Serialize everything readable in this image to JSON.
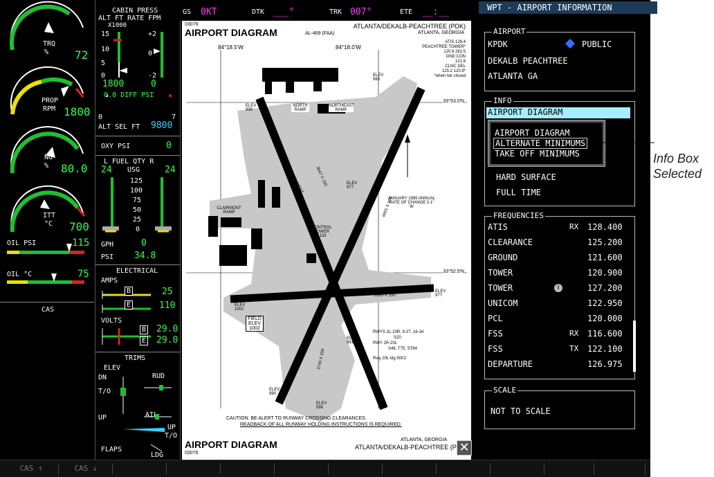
{
  "engine": {
    "trq_label": "TRQ",
    "trq_unit": "%",
    "trq_val": "72",
    "prop_label": "PROP",
    "prop_unit": "RPM",
    "prop_val": "1800",
    "ng_label": "NG",
    "ng_unit": "%",
    "ng_val": "80.0",
    "itt_label": "ITT",
    "itt_unit": "°C",
    "itt_val": "700",
    "oilpsi_label": "OIL PSI",
    "oilpsi_val": "115",
    "oiltemp_label": "OIL °C",
    "oiltemp_val": "75",
    "cas_label": "CAS"
  },
  "cabin": {
    "title": "CABIN PRESS",
    "subtitle": "ALT FT RATE FPM",
    "x1000": "X1000",
    "t15": "15",
    "t10": "10",
    "t5": "5",
    "t0": "0",
    "rp2": "+2",
    "r0": "0",
    "rm2": "-2",
    "alt_val": "1800",
    "rate_val": "0",
    "diff_label": "0.0 DIFF PSI",
    "diff0": "0",
    "diff7": "7",
    "altsel_label": "ALT SEL FT",
    "altsel_val": "9800",
    "oxy_label": "OXY PSI",
    "oxy_val": "0"
  },
  "fuel": {
    "title": "L  FUEL QTY  R",
    "unit": "USG",
    "left": "24",
    "right": "24",
    "ticks": [
      "125",
      "100",
      "75",
      "50",
      "25",
      "0"
    ],
    "gph_label": "GPH",
    "gph_val": "0",
    "psi_label": "PSI",
    "psi_val": "34.8"
  },
  "elec": {
    "title": "ELECTRICAL",
    "amps_label": "AMPS",
    "amps_b": "25",
    "amps_e": "110",
    "b": "B",
    "e": "E",
    "volts_label": "VOLTS",
    "volts_b": "29.0",
    "volts_e": "29.0"
  },
  "trims": {
    "title": "TRIMS",
    "elev": "ELEV",
    "dn": "DN",
    "to": "T/O",
    "rud": "RUD",
    "ail": "AIL",
    "up": "UP",
    "up2": "UP",
    "to2": "T/O",
    "flaps": "FLAPS",
    "ldg": "LDG"
  },
  "nav": {
    "gs_label": "GS",
    "gs_val": "0KT",
    "dtk_label": "DTK",
    "dtk_val": "___°",
    "trk_label": "TRK",
    "trk_val": "007°",
    "ete_label": "ETE",
    "ete_val": "__:__"
  },
  "chart": {
    "code": "03076",
    "title": "AIRPORT DIAGRAM",
    "al": "AL-469 (FAA)",
    "name": "ATLANTA/DEKALB-PEACHTREE (PDK)",
    "city": "ATLANTA, GEORGIA",
    "freqs": [
      "ATIS 128.4",
      "PEACHTREE TOWER*",
      "120.9 281.5",
      "GND CON",
      "121.6",
      "CLNC DEL",
      "125.2 120.9*",
      "*when twr closed"
    ],
    "lon1": "84°18.5'W",
    "lon2": "84°18.0'W",
    "lat1": "33°53.0'N",
    "lat2": "33°52.5'N",
    "elev983": "ELEV 983",
    "elev998": "ELEV 998",
    "elev977a": "ELEV 977",
    "elev977b": "ELEV 977",
    "elev1002": "ELEV 1002",
    "elev991": "ELEV 991",
    "elev990": "ELEV 990",
    "elev996": "ELEV 996",
    "north_ramp": "NORTH RAMP",
    "ne_ramp": "NORTHEAST RAMP",
    "nw_ramp": "NORTHWEST RAMP",
    "clairmont": "CLAIRMONT RAMP",
    "west_ramp": "WEST RAMP",
    "tower": "CONTROL TOWER 1133",
    "var": "JANUARY 1995 ANNUAL RATE OF CHANGE 0.1° W",
    "field": "FIELD ELEV 1002",
    "rwy_a": "6001 X 100",
    "rwy_b": "3383 X 150",
    "rwy_c": "3746 X 150",
    "rwy_d": "3647 X 150",
    "rwys": "RWYS 2L-20R, 9-27, 16-34",
    "rwys2": "S20",
    "rwys3": "RWY 2R-20L",
    "rwys4": "S46, T75, ST84",
    "rwys5": "Rwy 20L ldg 5001'",
    "caution1": "CAUTION: BE ALERT TO RUNWAY CROSSING CLEARANCES.",
    "caution2": "READBACK OF ALL RUNWAY HOLDING INSTRUCTIONS IS REQUIRED.",
    "foot_title": "AIRPORT DIAGRAM",
    "foot_code": "03076",
    "foot_city": "ATLANTA, GEORGIA",
    "foot_name": "ATLANTA/DEKALB-PEACHTREE (PDK)",
    "close": "✕"
  },
  "wpt": {
    "header": "WPT - AIRPORT INFORMATION",
    "airport_title": "AIRPORT",
    "ident": "KPDK",
    "public": "PUBLIC",
    "name": "DEKALB PEACHTREE",
    "city": "ATLANTA GA",
    "info_title": "INFO",
    "info_sel": "AIRPORT DIAGRAM",
    "menu": [
      "AIRPORT DIAGRAM",
      "ALTERNATE MINIMUMS",
      "TAKE OFF MINIMUMS"
    ],
    "surface": "HARD SURFACE",
    "fulltime": "FULL TIME",
    "freq_title": "FREQUENCIES",
    "freqs": [
      {
        "name": "ATIS",
        "tag": "RX",
        "val": "128.400"
      },
      {
        "name": "CLEARANCE",
        "tag": "",
        "val": "125.200"
      },
      {
        "name": "GROUND",
        "tag": "",
        "val": "121.600"
      },
      {
        "name": "TOWER",
        "tag": "",
        "val": "120.900"
      },
      {
        "name": "TOWER",
        "tag": "i",
        "val": "127.200"
      },
      {
        "name": "UNICOM",
        "tag": "",
        "val": "122.950"
      },
      {
        "name": "PCL",
        "tag": "",
        "val": "120.000"
      },
      {
        "name": "FSS",
        "tag": "RX",
        "val": "116.600"
      },
      {
        "name": "FSS",
        "tag": "TX",
        "val": "122.100"
      },
      {
        "name": "DEPARTURE",
        "tag": "",
        "val": "126.975"
      }
    ],
    "scale_title": "SCALE",
    "scale_val": "NOT TO SCALE"
  },
  "callout": "Info Box Selected",
  "softkeys": [
    "CAS ↑",
    "CAS ↓",
    "",
    "",
    "",
    "",
    "",
    "",
    "",
    "",
    "",
    ""
  ]
}
